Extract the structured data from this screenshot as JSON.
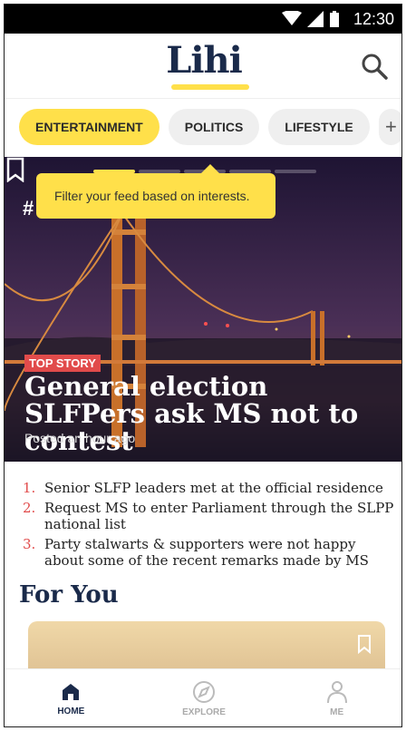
{
  "status_bar": {
    "time": "12:30"
  },
  "app": {
    "logo": "Lihi"
  },
  "categories": [
    {
      "label": "ENTERTAINMENT",
      "active": true
    },
    {
      "label": "POLITICS",
      "active": false
    },
    {
      "label": "LIFESTYLE",
      "active": false
    }
  ],
  "add_category": "+",
  "tooltip": {
    "text": "Filter your feed based on interests."
  },
  "hero": {
    "hashtag": "#",
    "tag": "TOP STORY",
    "headline": "General election SLFPers ask MS not to contest",
    "posted": "Posted an hour ago"
  },
  "highlights": [
    {
      "num": "1.",
      "text": "Senior SLFP leaders met at the official residence"
    },
    {
      "num": "2.",
      "text": "Request MS to enter Parliament through the SLPP national list"
    },
    {
      "num": "3.",
      "text": "Party stalwarts & supporters were not happy about some of the recent remarks made by MS"
    }
  ],
  "for_you": {
    "title": "For You"
  },
  "nav": [
    {
      "label": "HOME",
      "icon": "home-icon",
      "active": true
    },
    {
      "label": "EXPLORE",
      "icon": "compass-icon",
      "active": false
    },
    {
      "label": "ME",
      "icon": "person-icon",
      "active": false
    }
  ],
  "colors": {
    "accent": "#ffe04a",
    "brand": "#1a2a4a",
    "tag": "#e14b4b"
  }
}
